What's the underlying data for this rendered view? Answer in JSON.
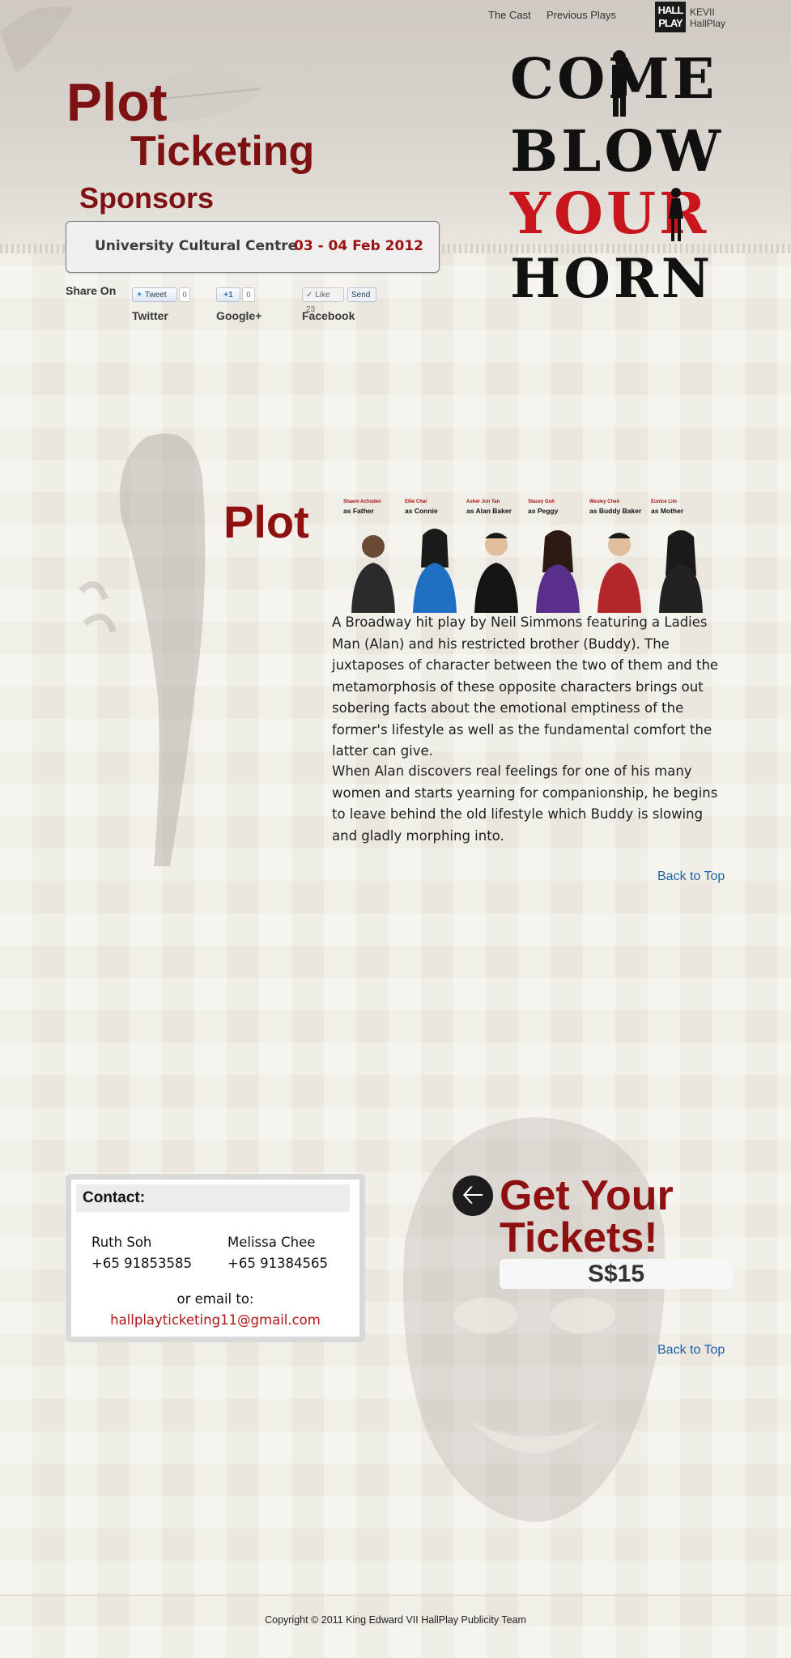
{
  "top_nav": {
    "cast": "The Cast",
    "previous_plays": "Previous Plays",
    "logo_text": "HALL PLAY",
    "org_line1": "KEVII",
    "org_line2": "HallPlay"
  },
  "main_nav": {
    "plot": "Plot",
    "ticketing": "Ticketing",
    "sponsors": "Sponsors"
  },
  "venue": {
    "name": "University Cultural Centre",
    "date": "03 - 04 Feb 2012"
  },
  "share": {
    "label": "Share On",
    "tweet_label": "Tweet",
    "tweet_count": "0",
    "plusone_label": "+1",
    "plusone_count": "0",
    "like_label": "Like",
    "like_count": "23",
    "send_label": "Send",
    "twitter": "Twitter",
    "googleplus": "Google+",
    "facebook": "Facebook"
  },
  "poster": {
    "line1": "COME",
    "line2": "BLOW",
    "line3": "YOUR",
    "line4": "HORN",
    "color_red": "#c8161c",
    "color_black": "#111111"
  },
  "plot": {
    "heading": "Plot",
    "paragraph1": "A Broadway hit play by Neil Simmons featuring a Ladies Man (Alan) and his restricted brother (Buddy). The juxtaposes of character between the two of them and the metamorphosis of these opposite characters brings out sobering facts about the emotional emptiness of the former's lifestyle as well as the fundamental comfort the latter can give.",
    "paragraph2": "When Alan discovers real feelings for one of his many women and starts yearning for companionship, he begins to leave behind the old lifestyle which Buddy is slowing and gladly morphing into.",
    "back_to_top": "Back to Top"
  },
  "cast": [
    {
      "actor": "Shaem Achuden",
      "role": "as Father"
    },
    {
      "actor": "Ellie Chai",
      "role": "as Connie"
    },
    {
      "actor": "Asher Jon Tan",
      "role": "as Alan Baker"
    },
    {
      "actor": "Stacey Goh",
      "role": "as Peggy"
    },
    {
      "actor": "Wesley Chen",
      "role": "as Buddy Baker"
    },
    {
      "actor": "Eunice Lim",
      "role": "as Mother"
    }
  ],
  "contact": {
    "title": "Contact:",
    "person1_name": "Ruth Soh",
    "person1_phone": "+65 91853585",
    "person2_name": "Melissa Chee",
    "person2_phone": "+65 91384565",
    "email_label": "or email to:",
    "email": "hallplayticketing11@gmail.com"
  },
  "tickets": {
    "line1": "Get Your",
    "line2": "Tickets!",
    "price": "S$15",
    "back_to_top": "Back to Top"
  },
  "footer": {
    "copyright": "Copyright © 2011 King Edward VII HallPlay Publicity Team"
  }
}
